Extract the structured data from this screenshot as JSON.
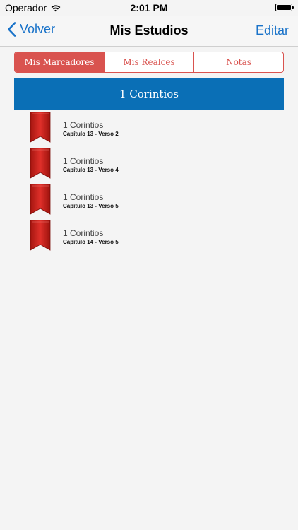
{
  "status_bar": {
    "carrier": "Operador",
    "time": "2:01 PM"
  },
  "nav": {
    "back_label": "Volver",
    "title": "Mis Estudios",
    "edit_label": "Editar"
  },
  "segments": [
    {
      "label": "Mis Marcadores",
      "active": true
    },
    {
      "label": "Mis Realces",
      "active": false
    },
    {
      "label": "Notas",
      "active": false
    }
  ],
  "section": {
    "title": "1 Corintios"
  },
  "items": [
    {
      "book": "1 Corintios",
      "reference": "Capítulo 13 - Verso 2"
    },
    {
      "book": "1 Corintios",
      "reference": "Capítulo 13 - Verso 4"
    },
    {
      "book": "1 Corintios",
      "reference": "Capítulo 13 - Verso 5"
    },
    {
      "book": "1 Corintios",
      "reference": "Capítulo 14 - Verso 5"
    }
  ],
  "colors": {
    "accent_blue": "#1a73c9",
    "segment_red": "#d9534f",
    "header_blue": "#0a6fb6",
    "ribbon_red": "#c9231d"
  },
  "icons": {
    "back": "chevron-left-icon",
    "wifi": "wifi-icon",
    "battery": "battery-icon",
    "bookmark": "bookmark-ribbon-icon"
  }
}
